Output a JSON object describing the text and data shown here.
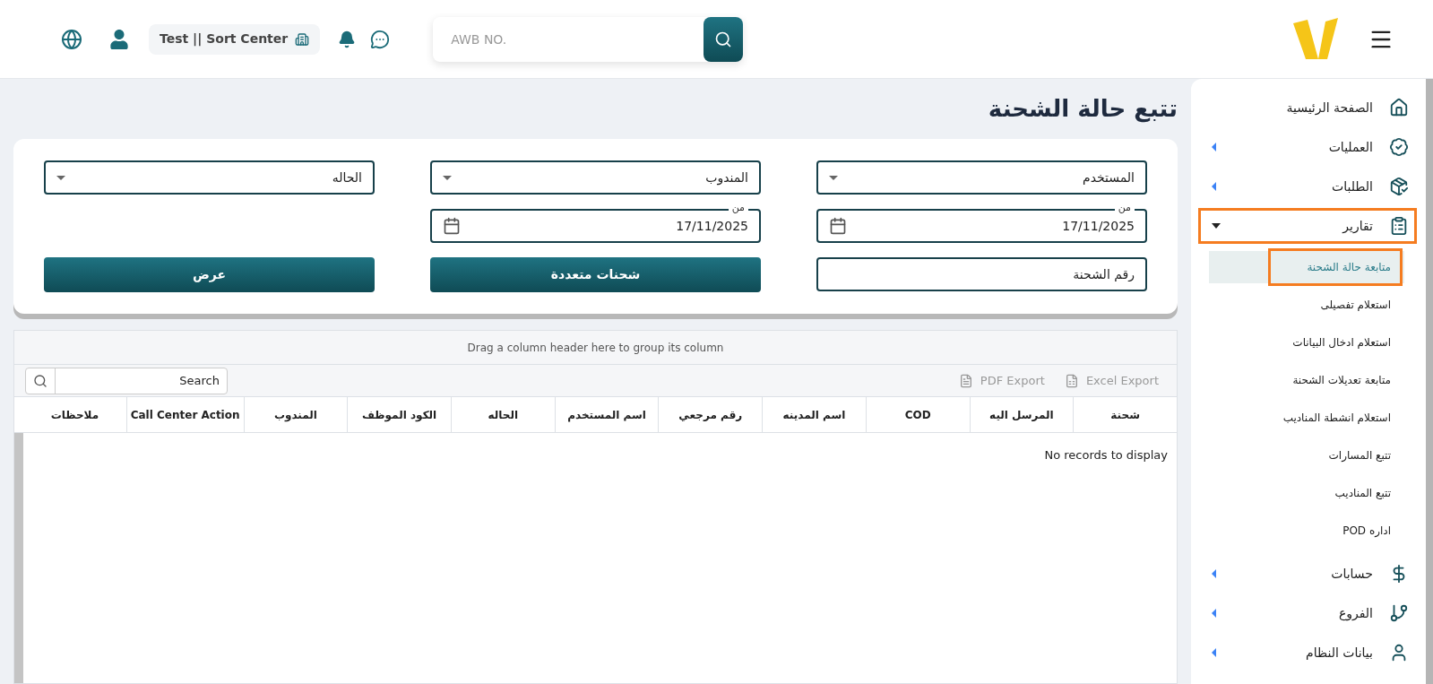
{
  "header": {
    "branch": "Test || Sort Center",
    "search": {
      "placeholder": "AWB NO."
    }
  },
  "page_title": "تتبع حالة الشحنة",
  "filters": {
    "selects": [
      {
        "label": "المستخدم"
      },
      {
        "label": "المندوب"
      },
      {
        "label": "الحاله"
      }
    ],
    "dates": [
      {
        "label": "من",
        "value": "17/11/2025"
      },
      {
        "label": "من",
        "value": "17/11/2025"
      }
    ],
    "shipment_field": {
      "placeholder": "رقم الشحنة"
    },
    "buttons": [
      "شحنات متعددة",
      "عرض"
    ]
  },
  "grid": {
    "group_panel": "Drag a column header here to group its column",
    "search": {
      "placeholder": "Search"
    },
    "exports": [
      {
        "kind": "excel",
        "label": "Excel Export"
      },
      {
        "kind": "pdf",
        "label": "PDF Export"
      }
    ],
    "columns": [
      "شحنة",
      "المرسل اليه",
      "COD",
      "اسم المدينه",
      "رقم مرجعي",
      "اسم المستخدم",
      "الحاله",
      "الكود الموظف",
      "المندوب",
      "Call Center Action",
      "ملاحظات"
    ],
    "empty_text": "No records to display"
  },
  "sidebar": {
    "items": [
      {
        "kind": "home",
        "label": "الصفحة الرئيسية",
        "expandable": false,
        "expanded": false
      },
      {
        "kind": "operations",
        "label": "العمليات",
        "expandable": true,
        "expanded": false
      },
      {
        "kind": "orders",
        "label": "الطلبات",
        "expandable": true,
        "expanded": false
      },
      {
        "kind": "reports",
        "label": "تقارير",
        "expandable": true,
        "expanded": true,
        "children": [
          {
            "label": "متابعة حالة الشحنة",
            "selected": true
          },
          {
            "label": "استعلام تفصيلى",
            "selected": false
          },
          {
            "label": "استعلام ادخال البيانات",
            "selected": false
          },
          {
            "label": "متابعة تعديلات الشحنة",
            "selected": false
          },
          {
            "label": "استعلام انشطة المناديب",
            "selected": false
          },
          {
            "label": "تتبع المسارات",
            "selected": false
          },
          {
            "label": "تتبع المناديب",
            "selected": false
          },
          {
            "label": "اداره POD",
            "selected": false
          }
        ]
      },
      {
        "kind": "accounts",
        "label": "حسابات",
        "expandable": true,
        "expanded": false
      },
      {
        "kind": "branches",
        "label": "الفروع",
        "expandable": true,
        "expanded": false
      },
      {
        "kind": "system",
        "label": "بيانات النظام",
        "expandable": true,
        "expanded": false
      }
    ]
  }
}
